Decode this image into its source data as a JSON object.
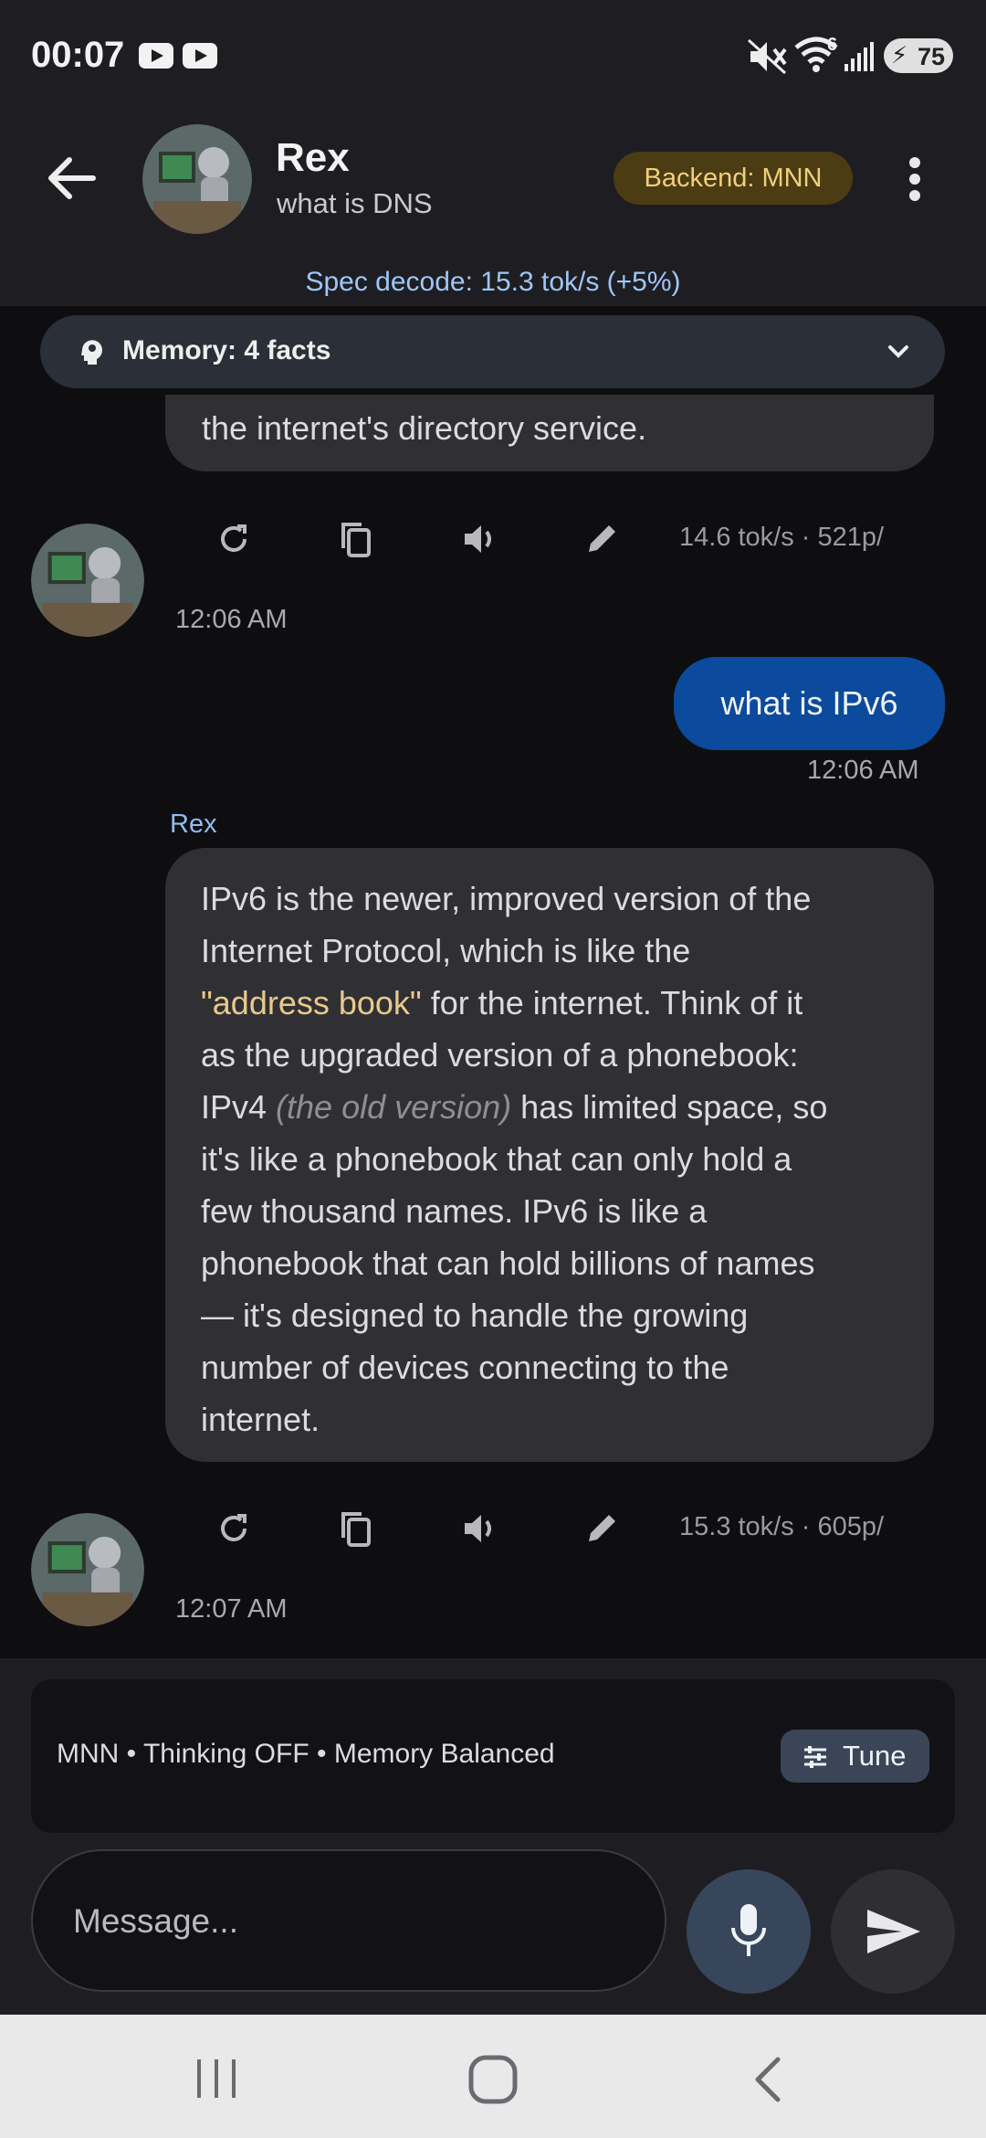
{
  "status_bar": {
    "time": "00:07",
    "battery": "75",
    "icons": [
      "youtube-icon",
      "youtube-icon",
      "mute-icon",
      "wifi-icon",
      "signal-icon",
      "battery-icon"
    ],
    "wifi_badge": "6"
  },
  "header": {
    "name": "Rex",
    "subtitle": "what is DNS",
    "backend_badge": "Backend: MNN",
    "spec_decode": "Spec decode: 15.3 tok/s (+5%)"
  },
  "memory": {
    "label": "Memory: 4 facts"
  },
  "messages": {
    "prev_ai": {
      "text_tail": "the internet's directory service.",
      "stats": "14.6 tok/s · 521p/",
      "time": "12:06 AM"
    },
    "user": {
      "text": "what is IPv6",
      "time": "12:06 AM"
    },
    "ai": {
      "sender": "Rex",
      "lines": [
        "IPv6 is the newer, improved version of the",
        "Internet Protocol, which is like the",
        "\"address book\"",
        " for the internet. Think of it",
        "as the upgraded version of a phonebook:",
        "IPv4 ",
        "(the old version)",
        " has limited space, so",
        "it's like a phonebook that can only hold a",
        "few thousand names. IPv6 is like a",
        "phonebook that can hold billions of names",
        "— it's designed to handle the growing",
        "number of devices connecting to the",
        "internet."
      ],
      "stats": "15.3 tok/s · 605p/",
      "time": "12:07 AM"
    }
  },
  "composer": {
    "settings_summary": "MNN • Thinking OFF • Memory Balanced",
    "tune_label": "Tune",
    "placeholder": "Message..."
  },
  "colors": {
    "background": "#0e0e10",
    "bar": "#1e1e22",
    "user_bubble": "#0b4a9c",
    "ai_bubble": "#303034",
    "badge_bg": "#4b3c14",
    "badge_text": "#f1cf7a",
    "accent_blue": "#8fbef5",
    "highlight": "#e9c98b"
  }
}
